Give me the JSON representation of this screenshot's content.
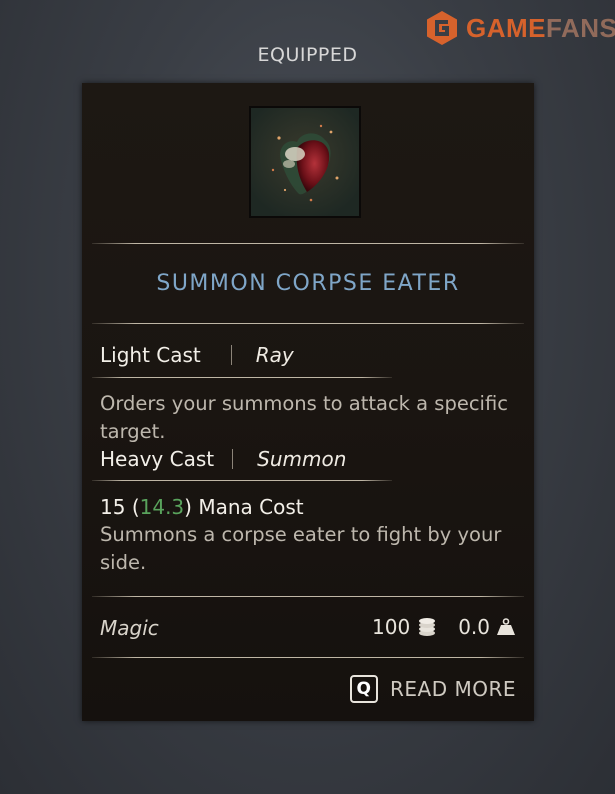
{
  "watermark": {
    "brand_a": "GAME",
    "brand_b": "FANS",
    "icon": "gamefans-logo"
  },
  "header": {
    "title": "EQUIPPED"
  },
  "item": {
    "icon": "summon-corpse-eater-icon",
    "name": "SUMMON CORPSE EATER",
    "light_cast": {
      "label": "Light Cast",
      "type": "Ray",
      "description": "Orders your summons to attack a specific target."
    },
    "heavy_cast": {
      "label": "Heavy Cast",
      "type": "Summon"
    },
    "mana": {
      "base": "15",
      "open": "(",
      "modified": "14.3",
      "close": ")",
      "label": "Mana Cost"
    },
    "heavy_description": "Summons a corpse eater to fight by your side.",
    "category": "Magic",
    "value": "100",
    "value_icon": "coins-icon",
    "weight": "0.0",
    "weight_icon": "weight-icon"
  },
  "actions": {
    "read_more_key": "Q",
    "read_more_label": "READ MORE"
  },
  "colors": {
    "title_blue": "#7fa6c8",
    "mana_green": "#59a35c",
    "brand_orange": "#e8672a"
  }
}
